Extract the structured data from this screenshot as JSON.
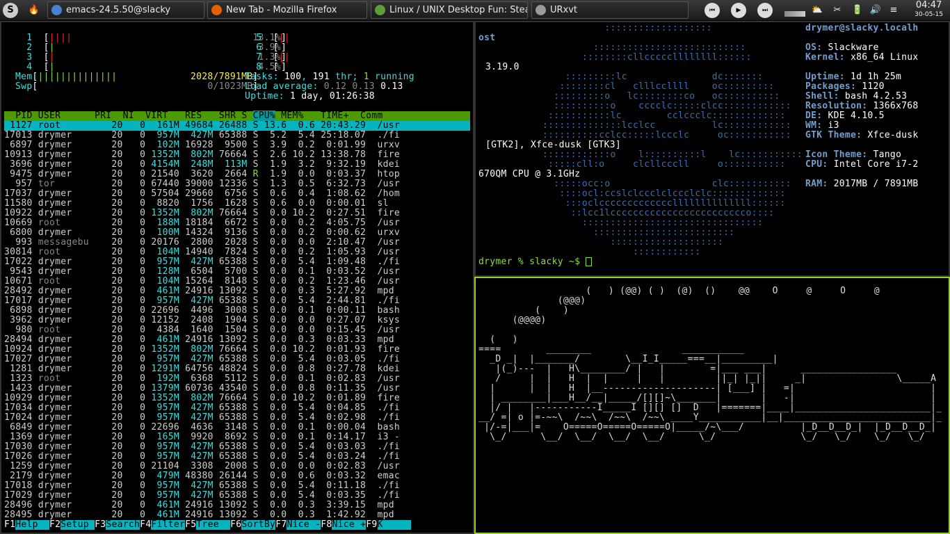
{
  "taskbar": {
    "tasks": [
      {
        "label": "emacs-24.5.50@slacky",
        "color": "#4a7fd4"
      },
      {
        "label": "New Tab - Mozilla Firefox",
        "color": "#e66000"
      },
      {
        "label": "Linux / UNIX Desktop Fun: Stea",
        "color": "#5c9e3a"
      },
      {
        "label": "URxvt",
        "color": "#999999"
      }
    ],
    "time": "04:47",
    "date": "30-05-15"
  },
  "htop": {
    "cpus": [
      {
        "n": "1",
        "pct": "13.1%"
      },
      {
        "n": "2",
        "pct": "3.9%"
      },
      {
        "n": "3",
        "pct": "1.3%"
      },
      {
        "n": "4",
        "pct": "4.5%"
      },
      {
        "n": "5",
        "pct": "6.5%"
      },
      {
        "n": "6",
        "pct": "0.0%"
      },
      {
        "n": "7",
        "pct": "3.2%"
      },
      {
        "n": "8",
        "pct": "0.0%"
      }
    ],
    "mem": "2028/7891MB",
    "swp": "0/1023MB",
    "tasks": "100",
    "thr": "191",
    "running": "1",
    "load1": "0.12",
    "load5": "0.13",
    "load15": "0.13",
    "uptime": "1 day, 01:26:38",
    "header": "  PID USER      PRI  NI  VIRT   RES   SHR S CPU% MEM%   TIME+  Comm",
    "rows": [
      [
        "1127",
        "root",
        "20",
        "0",
        "161M",
        "49684",
        "26488",
        "S",
        "13.6",
        "0.6",
        "20:43.29",
        "/usr"
      ],
      [
        "17013",
        "drymer",
        "20",
        "0",
        "957M",
        "427M",
        "65388",
        "S",
        "5.2",
        "5.4",
        "25:18.07",
        "./fi"
      ],
      [
        "6897",
        "drymer",
        "20",
        "0",
        "102M",
        "16928",
        "9500",
        "S",
        "3.9",
        "0.2",
        "0:01.99",
        "urxv"
      ],
      [
        "10913",
        "drymer",
        "20",
        "0",
        "1352M",
        "802M",
        "76664",
        "S",
        "2.6",
        "10.2",
        "13:38.78",
        "fire"
      ],
      [
        "3696",
        "drymer",
        "20",
        "0",
        "4154M",
        "248M",
        "113M",
        "S",
        "1.9",
        "3.2",
        "9:32.19",
        "kdei"
      ],
      [
        "9475",
        "drymer",
        "20",
        "0",
        "21540",
        "3620",
        "2664",
        "R",
        "1.9",
        "0.0",
        "0:03.37",
        "htop"
      ],
      [
        "957",
        "tor",
        "20",
        "0",
        "67440",
        "39000",
        "12336",
        "S",
        "1.3",
        "0.5",
        "6:32.73",
        "/usr"
      ],
      [
        "17037",
        "drymer",
        "20",
        "0",
        "57504",
        "29660",
        "6756",
        "S",
        "0.6",
        "0.4",
        "1:08.62",
        "/hom"
      ],
      [
        "11580",
        "drymer",
        "20",
        "0",
        "8820",
        "1756",
        "1628",
        "S",
        "0.6",
        "0.0",
        "0:00.01",
        "sl"
      ],
      [
        "10922",
        "drymer",
        "20",
        "0",
        "1352M",
        "802M",
        "76664",
        "S",
        "0.0",
        "10.2",
        "0:27.51",
        "fire"
      ],
      [
        "10669",
        "root",
        "20",
        "0",
        "188M",
        "18184",
        "6672",
        "S",
        "0.0",
        "0.2",
        "4:05.75",
        "/usr"
      ],
      [
        "6800",
        "drymer",
        "20",
        "0",
        "100M",
        "14324",
        "9136",
        "S",
        "0.0",
        "0.2",
        "0:00.62",
        "urxv"
      ],
      [
        "993",
        "messagebu",
        "20",
        "0",
        "20176",
        "2800",
        "2028",
        "S",
        "0.0",
        "0.0",
        "2:10.47",
        "/usr"
      ],
      [
        "30814",
        "root",
        "20",
        "0",
        "104M",
        "14940",
        "7824",
        "S",
        "0.0",
        "0.2",
        "1:05.93",
        "/usr"
      ],
      [
        "17022",
        "drymer",
        "20",
        "0",
        "957M",
        "427M",
        "65388",
        "S",
        "0.0",
        "5.4",
        "1:09.48",
        "./fi"
      ],
      [
        "9543",
        "drymer",
        "20",
        "0",
        "128M",
        "6504",
        "5700",
        "S",
        "0.0",
        "0.1",
        "0:03.52",
        "/usr"
      ],
      [
        "10671",
        "root",
        "20",
        "0",
        "104M",
        "15264",
        "8148",
        "S",
        "0.0",
        "0.2",
        "1:23.46",
        "/usr"
      ],
      [
        "28492",
        "drymer",
        "20",
        "0",
        "461M",
        "24916",
        "13092",
        "S",
        "0.0",
        "0.3",
        "5:27.92",
        "mpd"
      ],
      [
        "17017",
        "drymer",
        "20",
        "0",
        "957M",
        "427M",
        "65388",
        "S",
        "0.0",
        "5.4",
        "2:44.81",
        "./fi"
      ],
      [
        "6898",
        "drymer",
        "20",
        "0",
        "22696",
        "4496",
        "3008",
        "S",
        "0.0",
        "0.1",
        "0:00.11",
        "bash"
      ],
      [
        "3962",
        "drymer",
        "20",
        "0",
        "12152",
        "2408",
        "1904",
        "S",
        "0.0",
        "0.0",
        "0:27.07",
        "ksys"
      ],
      [
        "980",
        "root",
        "20",
        "0",
        "4384",
        "1640",
        "1504",
        "S",
        "0.0",
        "0.0",
        "0:15.45",
        "/usr"
      ],
      [
        "28494",
        "drymer",
        "20",
        "0",
        "461M",
        "24916",
        "13092",
        "S",
        "0.0",
        "0.3",
        "0:03.33",
        "mpd"
      ],
      [
        "10924",
        "drymer",
        "20",
        "0",
        "1352M",
        "802M",
        "76664",
        "S",
        "0.0",
        "10.2",
        "0:01.93",
        "fire"
      ],
      [
        "17027",
        "drymer",
        "20",
        "0",
        "957M",
        "427M",
        "65388",
        "S",
        "0.0",
        "5.4",
        "0:03.05",
        "./fi"
      ],
      [
        "1281",
        "drymer",
        "20",
        "0",
        "1291M",
        "64756",
        "48824",
        "S",
        "0.0",
        "0.8",
        "0:27.78",
        "kdei"
      ],
      [
        "1323",
        "root",
        "20",
        "0",
        "192M",
        "6368",
        "5112",
        "S",
        "0.0",
        "0.1",
        "0:02.83",
        "/usr"
      ],
      [
        "1423",
        "drymer",
        "20",
        "0",
        "1379M",
        "60736",
        "43540",
        "S",
        "0.0",
        "0.8",
        "0:11.35",
        "/usr"
      ],
      [
        "10929",
        "drymer",
        "20",
        "0",
        "1352M",
        "802M",
        "76664",
        "S",
        "0.0",
        "10.2",
        "0:01.89",
        "fire"
      ],
      [
        "17034",
        "drymer",
        "20",
        "0",
        "957M",
        "427M",
        "65388",
        "S",
        "0.0",
        "5.4",
        "0:04.85",
        "./fi"
      ],
      [
        "17024",
        "drymer",
        "20",
        "0",
        "957M",
        "427M",
        "65388",
        "S",
        "0.0",
        "5.4",
        "0:02.98",
        "./fi"
      ],
      [
        "6849",
        "drymer",
        "20",
        "0",
        "22696",
        "4636",
        "3148",
        "S",
        "0.0",
        "0.1",
        "0:00.04",
        "bash"
      ],
      [
        "1369",
        "drymer",
        "20",
        "0",
        "165M",
        "9920",
        "8692",
        "S",
        "0.0",
        "0.1",
        "0:14.17",
        "i3 -"
      ],
      [
        "17030",
        "drymer",
        "20",
        "0",
        "957M",
        "427M",
        "65388",
        "S",
        "0.0",
        "5.4",
        "0:03.03",
        "./fi"
      ],
      [
        "17026",
        "drymer",
        "20",
        "0",
        "957M",
        "427M",
        "65388",
        "S",
        "0.0",
        "5.4",
        "0:03.24",
        "./fi"
      ],
      [
        "1259",
        "drymer",
        "20",
        "0",
        "21104",
        "3308",
        "2008",
        "S",
        "0.0",
        "0.0",
        "0:02.83",
        "/usr"
      ],
      [
        "2179",
        "drymer",
        "20",
        "0",
        "479M",
        "48380",
        "26144",
        "S",
        "0.0",
        "0.6",
        "0:03.32",
        "emac"
      ],
      [
        "17018",
        "drymer",
        "20",
        "0",
        "957M",
        "427M",
        "65388",
        "S",
        "0.0",
        "5.4",
        "0:11.18",
        "./fi"
      ],
      [
        "17029",
        "drymer",
        "20",
        "0",
        "957M",
        "427M",
        "65388",
        "S",
        "0.0",
        "5.4",
        "0:03.35",
        "./fi"
      ],
      [
        "28496",
        "drymer",
        "20",
        "0",
        "461M",
        "24916",
        "13092",
        "S",
        "0.0",
        "0.3",
        "3:39.15",
        "mpd"
      ],
      [
        "28495",
        "drymer",
        "20",
        "0",
        "461M",
        "24916",
        "13092",
        "S",
        "0.0",
        "0.3",
        "1:42.92",
        "mpd"
      ]
    ],
    "fkeys": [
      [
        "F1",
        "Help"
      ],
      [
        "F2",
        "Setup"
      ],
      [
        "F3",
        "Search"
      ],
      [
        "F4",
        "Filter"
      ],
      [
        "F5",
        "Tree"
      ],
      [
        "F6",
        "SortBy"
      ],
      [
        "F7",
        "Nice -"
      ],
      [
        "F8",
        "Nice +"
      ],
      [
        "F9",
        "K"
      ]
    ]
  },
  "screenfetch": {
    "userhost": "drymer@slacky.localh",
    "ost": "ost",
    "kernel_wrap": "3.19.0",
    "gtk_wrap": "[GTK2], Xfce-dusk [GTK3]",
    "cpu_wrap": "670QM CPU @ 3.1GHz",
    "info": [
      [
        "OS:",
        "Slackware"
      ],
      [
        "Kernel:",
        "x86_64 Linux"
      ],
      [
        "",
        ""
      ],
      [
        "Uptime:",
        "1d 1h 25m"
      ],
      [
        "Packages:",
        "1120"
      ],
      [
        "Shell:",
        "bash 4.2.53"
      ],
      [
        "Resolution:",
        "1366x768"
      ],
      [
        "DE:",
        "KDE 4.10.5"
      ],
      [
        "WM:",
        "i3"
      ],
      [
        "GTK Theme:",
        "Xfce-dusk"
      ],
      [
        "",
        ""
      ],
      [
        "Icon Theme:",
        "Tango"
      ],
      [
        "CPU:",
        "Intel Core i7-2"
      ],
      [
        "",
        ""
      ],
      [
        "RAM:",
        "2017MB / 7891MB"
      ]
    ],
    "prompt": "drymer % slacky ~$ "
  },
  "sl": {
    "lines": [
      "                   (   ) (@@) ( )  (@)  ()    @@    O     @     O     @",
      "              (@@@)",
      "          (    )",
      "      (@@@@)",
      "",
      "  (   )",
      "====        ________                ___________",
      "  _D _|  |_______/        \\__I_I_____===__|_________|",
      "   |(_)---  |   H\\________/ |   |        =|___ ___|      _________________",
      "   /     |  |   H  |  |     |   |         ||_| |_||     _|                \\_____A",
      "  |      |  |   H  |__--------------------| [___] |   =|                        |",
      "  | ________|___H__/__|_____/[][]~\\_______|       |   -|                        |",
      "  |/ |   |-----------I_____I [][] []  D   |=======|____|________________________|_",
      "__/ =| o |=-~~\\  /~~\\  /~~\\  /~~\\ ____Y___________|__|__________________________|_",
      " |/-=|___|=    O=====O=====O=====O|_____/~\\___/          |_D__D__D_|  |_D__D__D_|",
      "  \\_/      \\__/  \\__/  \\__/  \\__/      \\_/               \\_/   \\_/    \\_/   \\_/"
    ]
  },
  "colors": {
    "accent": "#9acd32",
    "htop_header": "#4e9a06",
    "selection": "#06b4c0"
  }
}
